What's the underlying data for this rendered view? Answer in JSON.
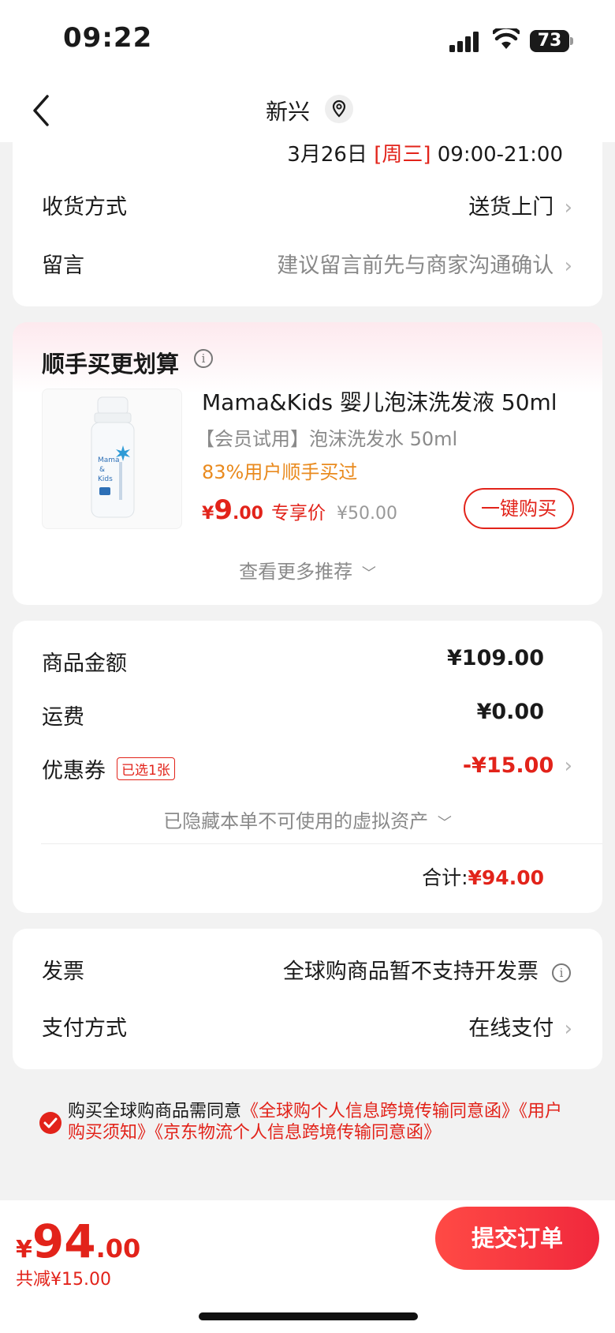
{
  "status_bar": {
    "time": "09:22",
    "battery": "73"
  },
  "nav": {
    "title": "新兴"
  },
  "delivery": {
    "time_date": "3月26日",
    "time_day": "[周三]",
    "time_range": "09:00-21:00",
    "method_label": "收货方式",
    "method_value": "送货上门",
    "note_label": "留言",
    "note_placeholder": "建议留言前先与商家沟通确认"
  },
  "upsell": {
    "title": "顺手买更划算",
    "product_name": "Mama&Kids 婴儿泡沫洗发液 50ml",
    "product_sub": "【会员试用】泡沫洗发水 50ml",
    "product_stat": "83%用户顺手买过",
    "price_yen": "¥",
    "price_int": "9",
    "price_dec": ".00",
    "price_tag": "专享价",
    "price_original": "¥50.00",
    "buy_button": "一键购买",
    "more_link": "查看更多推荐"
  },
  "summary": {
    "goods_label": "商品金额",
    "goods_value": "¥109.00",
    "shipping_label": "运费",
    "shipping_value": "¥0.00",
    "coupon_label": "优惠券",
    "coupon_badge": "已选1张",
    "coupon_value": "-¥15.00",
    "hidden_assets": "已隐藏本单不可使用的虚拟资产",
    "total_label": "合计:",
    "total_value": "¥94.00"
  },
  "invoice": {
    "invoice_label": "发票",
    "invoice_value": "全球购商品暂不支持开发票",
    "payment_label": "支付方式",
    "payment_value": "在线支付"
  },
  "agreement": {
    "prefix": "购买全球购商品需同意",
    "link1": "《全球购个人信息跨境传输同意函》",
    "link2": "《用户购买须知》",
    "link3": "《京东物流个人信息跨境传输同意函》"
  },
  "bottom_bar": {
    "yen": "¥",
    "total_int": "94",
    "total_dec": ".00",
    "saved": "共减¥15.00",
    "submit": "提交订单"
  },
  "colors": {
    "accent": "#e2231a",
    "orange": "#e98a1e",
    "background": "#f2f2f2"
  }
}
